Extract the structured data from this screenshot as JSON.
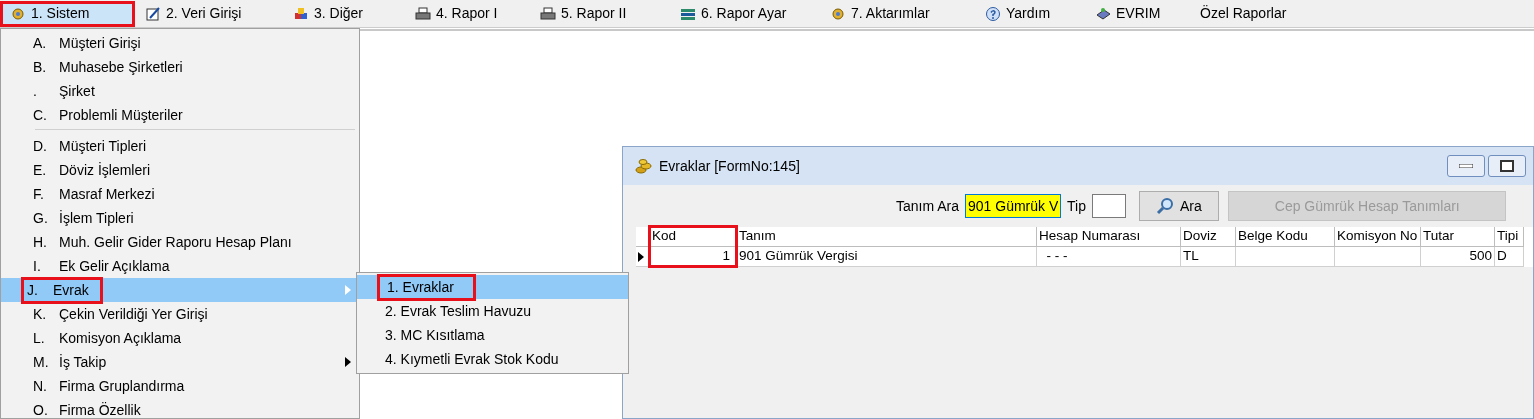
{
  "menubar": [
    {
      "label": "1.  Sistem",
      "selected": true,
      "highlighted": true
    },
    {
      "label": "2.  Veri Girişi",
      "selected": false,
      "highlighted": false
    },
    {
      "label": "3.  Diğer",
      "selected": false,
      "highlighted": false
    },
    {
      "label": "4.  Rapor I",
      "selected": false,
      "highlighted": false
    },
    {
      "label": "5.  Rapor II",
      "selected": false,
      "highlighted": false
    },
    {
      "label": "6.  Rapor Ayar",
      "selected": false,
      "highlighted": false
    },
    {
      "label": "7.  Aktarımlar",
      "selected": false,
      "highlighted": false
    },
    {
      "label": "Yardım",
      "selected": false,
      "highlighted": false
    },
    {
      "label": "EVRIM",
      "selected": false,
      "highlighted": false
    },
    {
      "label": "Özel Raporlar",
      "selected": false,
      "highlighted": false
    }
  ],
  "dropdown": {
    "items": [
      {
        "key": "A.",
        "label": "Müşteri Girişi",
        "selected": false,
        "highlighted": false,
        "submenu": false
      },
      {
        "key": "B.",
        "label": "Muhasebe Şirketleri",
        "selected": false,
        "highlighted": false,
        "submenu": false
      },
      {
        "key": ".",
        "label": "Şirket",
        "selected": false,
        "highlighted": false,
        "submenu": false
      },
      {
        "key": "C.",
        "label": "Problemli Müşteriler",
        "selected": false,
        "highlighted": false,
        "separator_after": true
      },
      {
        "key": "D.",
        "label": "Müşteri Tipleri",
        "selected": false,
        "highlighted": false,
        "submenu": false
      },
      {
        "key": "E.",
        "label": "Döviz İşlemleri",
        "selected": false,
        "highlighted": false,
        "submenu": false
      },
      {
        "key": "F.",
        "label": "Masraf Merkezi",
        "selected": false,
        "highlighted": false,
        "submenu": false
      },
      {
        "key": "G.",
        "label": "İşlem Tipleri",
        "selected": false,
        "highlighted": false,
        "submenu": false
      },
      {
        "key": "H.",
        "label": "Muh. Gelir Gider Raporu Hesap Planı",
        "selected": false,
        "highlighted": false,
        "submenu": false
      },
      {
        "key": "I.",
        "label": "Ek Gelir Açıklama",
        "selected": false,
        "highlighted": false,
        "submenu": false
      },
      {
        "key": "J.",
        "label": "Evrak",
        "selected": true,
        "highlighted": true,
        "submenu": true
      },
      {
        "key": "K.",
        "label": "Çekin Verildiği Yer Girişi",
        "selected": false,
        "highlighted": false,
        "submenu": false
      },
      {
        "key": "L.",
        "label": "Komisyon Açıklama",
        "selected": false,
        "highlighted": false,
        "submenu": false
      },
      {
        "key": "M.",
        "label": "İş Takip",
        "selected": false,
        "highlighted": false,
        "submenu": true
      },
      {
        "key": "N.",
        "label": "Firma Gruplandırma",
        "selected": false,
        "highlighted": false,
        "submenu": false
      },
      {
        "key": "O.",
        "label": "Firma Özellik",
        "selected": false,
        "highlighted": false,
        "submenu": false
      }
    ]
  },
  "submenu": {
    "items": [
      {
        "label": "1.   Evraklar",
        "selected": true,
        "highlighted": true
      },
      {
        "label": "2.   Evrak Teslim Havuzu",
        "selected": false,
        "highlighted": false
      },
      {
        "label": "3.   MC Kısıtlama",
        "selected": false,
        "highlighted": false
      },
      {
        "label": "4. Kıymetli Evrak Stok Kodu",
        "selected": false,
        "highlighted": false
      }
    ]
  },
  "window": {
    "title": "Evraklar [FormNo:145]",
    "search": {
      "label": "Tanım Ara",
      "value": "901 Gümrük V",
      "tip_label": "Tip",
      "search_button": "Ara",
      "extra_button": {
        "label": "Cep Gümrük Hesap Tanımları",
        "disabled": true
      }
    },
    "table": {
      "columns": [
        {
          "label": "Kod",
          "highlighted": true
        },
        {
          "label": "Tanım",
          "highlighted": false
        },
        {
          "label": "Hesap Numarası",
          "highlighted": false
        },
        {
          "label": "Doviz",
          "highlighted": false
        },
        {
          "label": "Belge Kodu",
          "highlighted": false
        },
        {
          "label": "Komisyon No",
          "highlighted": false
        },
        {
          "label": "Tutar",
          "highlighted": false
        },
        {
          "label": "Tipi",
          "highlighted": false
        }
      ],
      "rows": [
        {
          "current": true,
          "cells": [
            "1",
            "901 Gümrük Vergisi",
            "  - - -",
            "TL",
            "",
            "",
            "500",
            "D"
          ]
        }
      ]
    }
  }
}
